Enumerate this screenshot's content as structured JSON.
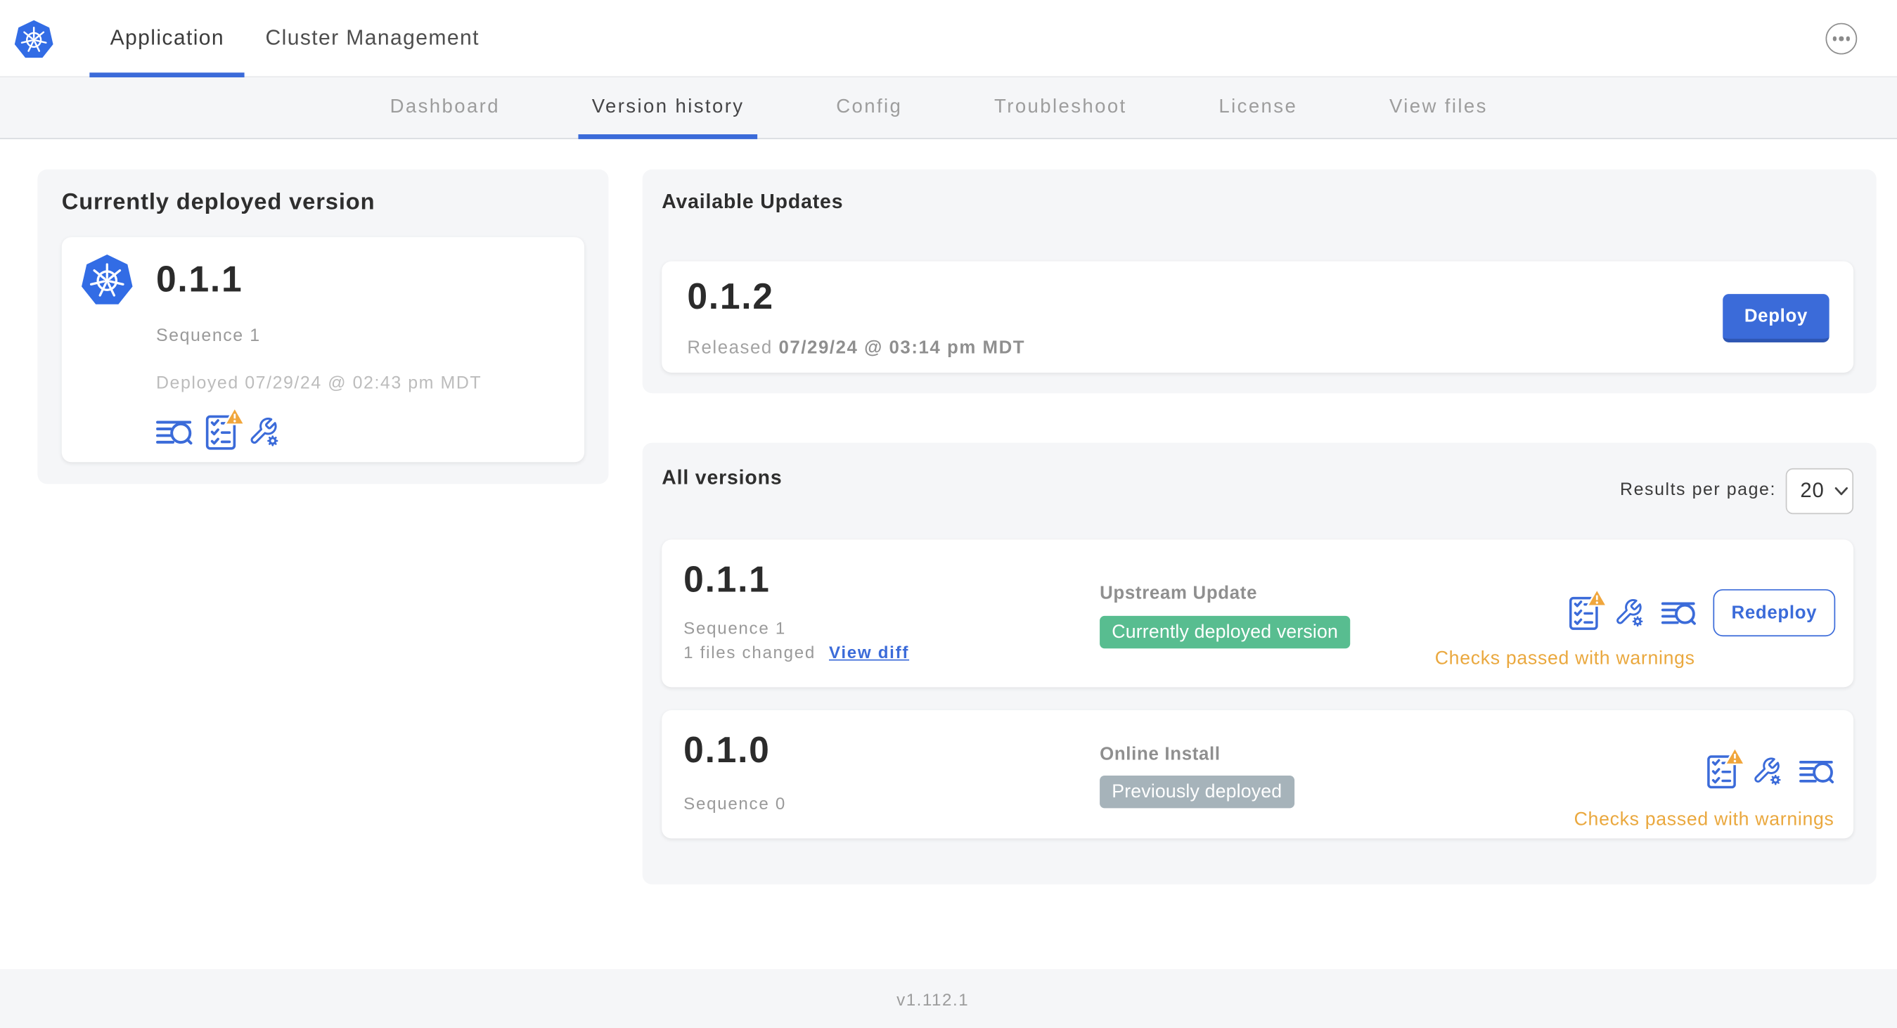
{
  "colors": {
    "accent-blue": "#3b6bd9",
    "k8s-blue": "#326ce5",
    "badge-green": "#58bd90",
    "badge-gray": "#a6b3ba",
    "warning-orange": "#eaa83e",
    "card-bg": "#f5f6f8",
    "text-dark": "#2e2e2e",
    "text-gray": "#9a9a9a"
  },
  "icons": {
    "logo": "kubernetes-logo",
    "menu": "ellipsis-icon",
    "checks": "preflight-checklist-icon",
    "config": "wrench-gear-icon",
    "logs": "file-search-icon",
    "warning": "warning-triangle-icon",
    "dropdown": "chevron-down-icon"
  },
  "header": {
    "tabs": [
      {
        "label": "Application"
      },
      {
        "label": "Cluster Management"
      }
    ]
  },
  "subnav": {
    "tabs": [
      "Dashboard",
      "Version history",
      "Config",
      "Troubleshoot",
      "License",
      "View files"
    ]
  },
  "current_version_card": {
    "title": "Currently deployed version",
    "version": "0.1.1",
    "sequence": "Sequence 1",
    "deployed": "Deployed 07/29/24 @ 02:43 pm MDT"
  },
  "available_updates": {
    "title": "Available Updates",
    "version": "0.1.2",
    "released_prefix": "Released",
    "released_date": "07/29/24 @ 03:14 pm MDT",
    "deploy_label": "Deploy"
  },
  "all_versions": {
    "title": "All versions",
    "results_label": "Results per page:",
    "results_value": "20",
    "rows": [
      {
        "version": "0.1.1",
        "sequence": "Sequence 1",
        "files_changed": "1 files changed",
        "view_diff": "View diff",
        "source": "Upstream Update",
        "badge": "Currently deployed version",
        "status": "Checks passed with warnings",
        "action": "Redeploy"
      },
      {
        "version": "0.1.0",
        "sequence": "Sequence 0",
        "source": "Online Install",
        "badge": "Previously deployed",
        "status": "Checks passed with warnings"
      }
    ]
  },
  "footer": {
    "version": "v1.112.1"
  }
}
